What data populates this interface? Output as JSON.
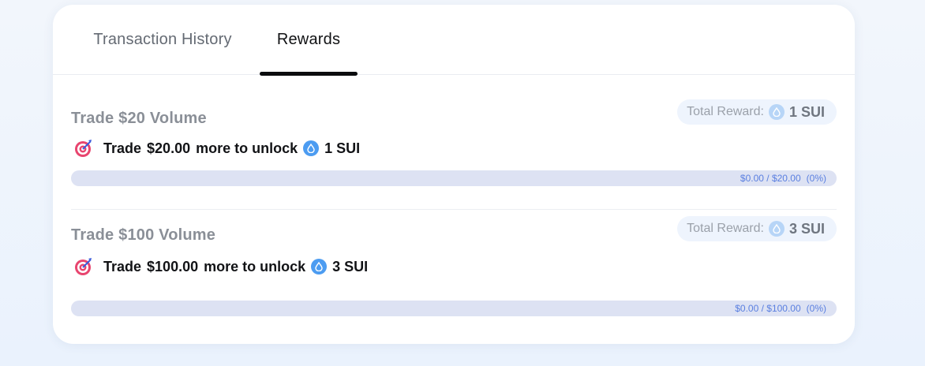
{
  "tabs": [
    {
      "label": "Transaction History",
      "active": false
    },
    {
      "label": "Rewards",
      "active": true
    }
  ],
  "rewards": [
    {
      "title": "Trade $20 Volume",
      "total_label": "Total Reward:",
      "total_amount": "1 SUI",
      "unlock_prefix": "Trade",
      "unlock_amount": "$20.00",
      "unlock_middle": "more to unlock",
      "unlock_reward": "1 SUI",
      "progress_text": "$0.00 / $20.00",
      "progress_percent_text": "(0%)",
      "progress_fraction": 0
    },
    {
      "title": "Trade $100 Volume",
      "total_label": "Total Reward:",
      "total_amount": "3 SUI",
      "unlock_prefix": "Trade",
      "unlock_amount": "$100.00",
      "unlock_middle": "more to unlock",
      "unlock_reward": "3 SUI",
      "progress_text": "$0.00 / $100.00",
      "progress_percent_text": "(0%)",
      "progress_fraction": 0
    }
  ],
  "icons": {
    "target": "target-icon",
    "coin": "sui-coin-icon"
  },
  "colors": {
    "accent": "#4c9cf1",
    "progress_track": "#dde2f3",
    "progress_text": "#5a7fe0",
    "active_tab": "#0b0c0e"
  }
}
